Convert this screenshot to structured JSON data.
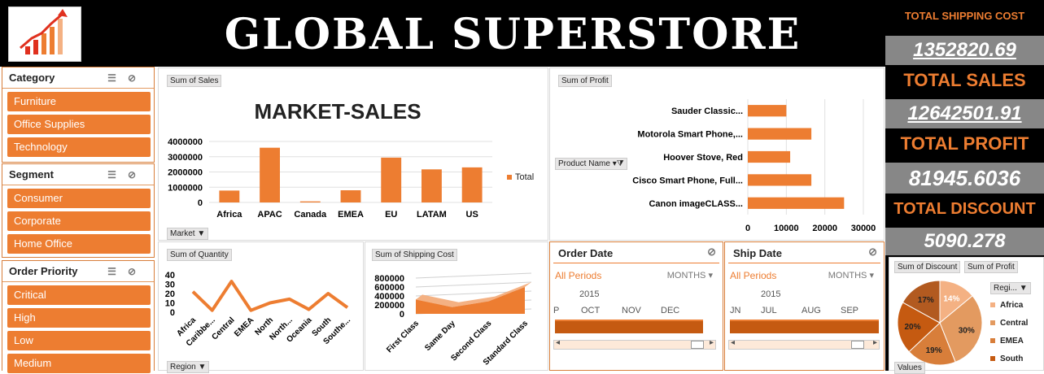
{
  "header": {
    "title": "GLOBAL SUPERSTORE"
  },
  "kpis": [
    {
      "label": "TOTAL SHIPPING COST",
      "value": "1352820.69"
    },
    {
      "label": "TOTAL SALES",
      "value": "12642501.91"
    },
    {
      "label": "TOTAL PROFIT",
      "value": "81945.6036"
    },
    {
      "label": "TOTAL DISCOUNT",
      "value": "5090.278"
    }
  ],
  "slicers": {
    "category": {
      "title": "Category",
      "items": [
        "Furniture",
        "Office Supplies",
        "Technology"
      ]
    },
    "segment": {
      "title": "Segment",
      "items": [
        "Consumer",
        "Corporate",
        "Home Office"
      ]
    },
    "priority": {
      "title": "Order Priority",
      "items": [
        "Critical",
        "High",
        "Low",
        "Medium"
      ]
    }
  },
  "market_sales": {
    "tag": "Sum of Sales",
    "filter_tag": "Market",
    "legend": "Total"
  },
  "profit_chart": {
    "tag": "Sum of Profit",
    "filter_tag": "Product Name"
  },
  "quantity_chart": {
    "tag": "Sum of Quantity",
    "filter_tag": "Region"
  },
  "shipping_chart": {
    "tag": "Sum of Shipping Cost"
  },
  "order_date": {
    "title": "Order Date",
    "all": "All Periods",
    "unit": "MONTHS",
    "year": "2015",
    "months": [
      "P",
      "OCT",
      "NOV",
      "DEC"
    ]
  },
  "ship_date": {
    "title": "Ship Date",
    "all": "All Periods",
    "unit": "MONTHS",
    "year": "2015",
    "months": [
      "JN",
      "JUL",
      "AUG",
      "SEP"
    ]
  },
  "pie_tags": {
    "discount": "Sum of Discount",
    "profit": "Sum of Profit",
    "region": "Regi...",
    "values": "Values"
  },
  "colors": {
    "accent": "#ed7d31",
    "dark_accent": "#c55a11",
    "kpi_bg": "#878787"
  },
  "chart_data": [
    {
      "type": "bar",
      "title": "MARKET-SALES",
      "categories": [
        "Africa",
        "APAC",
        "Canada",
        "EMEA",
        "EU",
        "LATAM",
        "US"
      ],
      "series": [
        {
          "name": "Total",
          "values": [
            780000,
            3590000,
            70000,
            800000,
            2940000,
            2170000,
            2300000
          ]
        }
      ],
      "yticks": [
        "4000000",
        "3000000",
        "2000000",
        "1000000",
        "0"
      ],
      "ylim": [
        0,
        4000000
      ]
    },
    {
      "type": "bar",
      "orientation": "horizontal",
      "categories": [
        "Sauder Classic...",
        "Motorola Smart Phone,...",
        "Hoover Stove, Red",
        "Cisco Smart Phone, Full...",
        "Canon imageCLASS..."
      ],
      "values": [
        10000,
        16500,
        11000,
        16500,
        25000
      ],
      "xticks": [
        "0",
        "10000",
        "20000",
        "30000"
      ],
      "xlim": [
        0,
        30000
      ]
    },
    {
      "type": "line",
      "categories": [
        "Africa",
        "Caribbe...",
        "Central",
        "EMEA",
        "North",
        "North...",
        "Oceania",
        "South",
        "Southe..."
      ],
      "values": [
        22,
        2,
        33,
        2,
        10,
        14,
        3,
        20,
        5
      ],
      "yticks": [
        "40",
        "30",
        "20",
        "10",
        "0"
      ],
      "ylim": [
        0,
        40
      ]
    },
    {
      "type": "area",
      "categories": [
        "First Class",
        "Same Day",
        "Second Class",
        "Standard Class"
      ],
      "values": [
        320000,
        150000,
        280000,
        600000
      ],
      "yticks": [
        "800000",
        "600000",
        "400000",
        "200000",
        "0"
      ],
      "ylim": [
        0,
        800000
      ]
    },
    {
      "type": "pie",
      "categories": [
        "Africa",
        "Central",
        "EMEA",
        "South"
      ],
      "values": [
        14,
        30,
        19,
        20,
        17
      ],
      "labels": [
        "14%",
        "30%",
        "19%",
        "20%",
        "17%"
      ]
    }
  ]
}
